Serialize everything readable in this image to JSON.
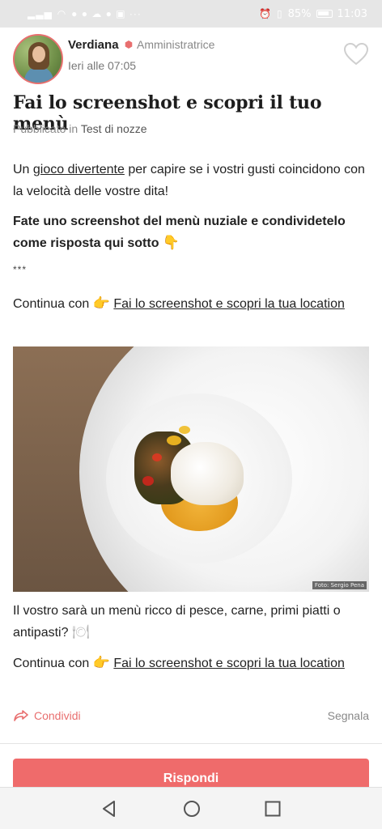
{
  "status_bar": {
    "battery_percent": "85%",
    "time": "11:03"
  },
  "post": {
    "author_name": "Verdiana",
    "author_role": "Amministratrice",
    "time": "Ieri alle 07:05",
    "title": "Fai lo screenshot e scopri il tuo menù",
    "published_prefix": "Pubblicato in",
    "category": "Test di nozze",
    "intro": {
      "part1": "Un ",
      "link": "gioco divertente",
      "part2": " per capire se i vostri gusti coincidono con la velocità delle vostre dita!"
    },
    "instruction": "Fate uno screenshot del menù nuziale e condividetelo come risposta qui sotto",
    "instruction_emoji": "👇",
    "separator": "***",
    "continue_1": {
      "prefix": "Continua con",
      "emoji": "👉",
      "link": "Fai lo screenshot e scopri la tua location"
    },
    "photo_credit": "Foto: Sergio Pena",
    "question": "Il vostro sarà un menù ricco di pesce, carne, primi piatti o antipasti?",
    "question_emoji": "🍽",
    "continue_2": {
      "prefix": "Continua con",
      "emoji": "👉",
      "link": "Fai lo screenshot e scopri la tua location"
    }
  },
  "actions": {
    "share_label": "Condividi",
    "report_label": "Segnala",
    "reply_label": "Rispondi"
  },
  "colors": {
    "accent": "#ef6b6b",
    "status_bar_bg": "#e6e6e6"
  }
}
